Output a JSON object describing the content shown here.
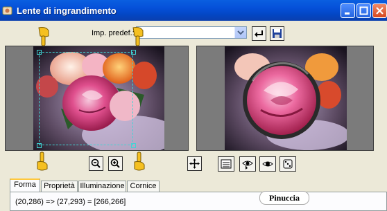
{
  "window": {
    "title": "Lente di ingrandimento",
    "icon": "app-hand-icon"
  },
  "titlebar_buttons": [
    "minimize-icon",
    "maximize-icon",
    "close-icon"
  ],
  "preset": {
    "label": "Imp. predef.:",
    "value": ""
  },
  "preset_buttons": [
    "reset-arrow-icon",
    "save-disk-icon"
  ],
  "zoom_buttons": [
    "zoom-out-icon",
    "zoom-in-icon"
  ],
  "move_button": "move-crosshair-icon",
  "right_tools": [
    "list-view-icon",
    "eye-pointer-icon",
    "eye-icon",
    "dice-icon"
  ],
  "tabs": [
    {
      "label": "Forma",
      "active": true
    },
    {
      "label": "Proprietà",
      "active": false
    },
    {
      "label": "Illuminazione",
      "active": false
    },
    {
      "label": "Cornice",
      "active": false
    }
  ],
  "status": {
    "coords": "(20,286) => (27,293) = [266,266]"
  },
  "watermark": "Pinuccia",
  "colors": {
    "titlebar": "#0550d8",
    "dialog_bg": "#ece9d8",
    "selection": "#3fd5d5",
    "tab_highlight": "#ffc83c"
  }
}
